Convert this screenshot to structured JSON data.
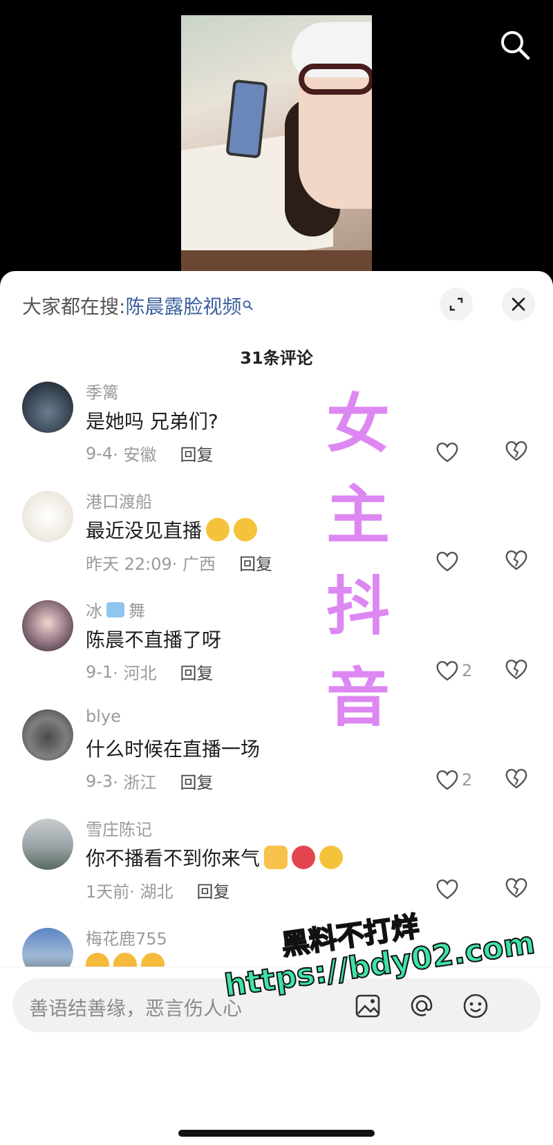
{
  "hot_search": {
    "prefix": "大家都在搜:",
    "query": "陈晨露脸视频"
  },
  "comment_count": "31条评论",
  "comments": [
    {
      "user": "季篱",
      "text": "是她吗 兄弟们?",
      "date": "9-4",
      "location": "· 安徽",
      "reply": "回复",
      "likes": ""
    },
    {
      "user": "港口渡船",
      "text": "最近没见直播",
      "date": "昨天 22:09",
      "location": "· 广西",
      "reply": "回复",
      "likes": ""
    },
    {
      "user": "冰",
      "user_suffix": "舞",
      "text": "陈晨不直播了呀",
      "date": "9-1",
      "location": "· 河北",
      "reply": "回复",
      "likes": "2"
    },
    {
      "user": "blye",
      "text": "什么时候在直播一场",
      "date": "9-3",
      "location": "· 浙江",
      "reply": "回复",
      "likes": "2"
    },
    {
      "user": "雪庄陈记",
      "text": "你不播看不到你来气",
      "date": "1天前",
      "location": "· 湖北",
      "reply": "回复",
      "likes": ""
    },
    {
      "user": "梅花鹿755",
      "text": "",
      "date": "",
      "location": "",
      "reply": "",
      "likes": ""
    }
  ],
  "watermark_vertical": [
    "女",
    "主",
    "抖",
    "音"
  ],
  "watermark_url": {
    "line1": "黑料不打烊",
    "line2": "https://bdy02.com"
  },
  "input": {
    "placeholder": "善语结善缘，恶言伤人心"
  },
  "icons": {
    "search": "search-icon",
    "expand": "expand-icon",
    "close": "close-icon",
    "like": "heart-icon",
    "dislike": "broken-heart-icon",
    "image": "image-icon",
    "mention": "at-icon",
    "emoji": "emoji-icon"
  },
  "colors": {
    "link": "#3a5f9e",
    "watermark_purple": "#dd88f2",
    "watermark_green": "#3fe3a6"
  }
}
